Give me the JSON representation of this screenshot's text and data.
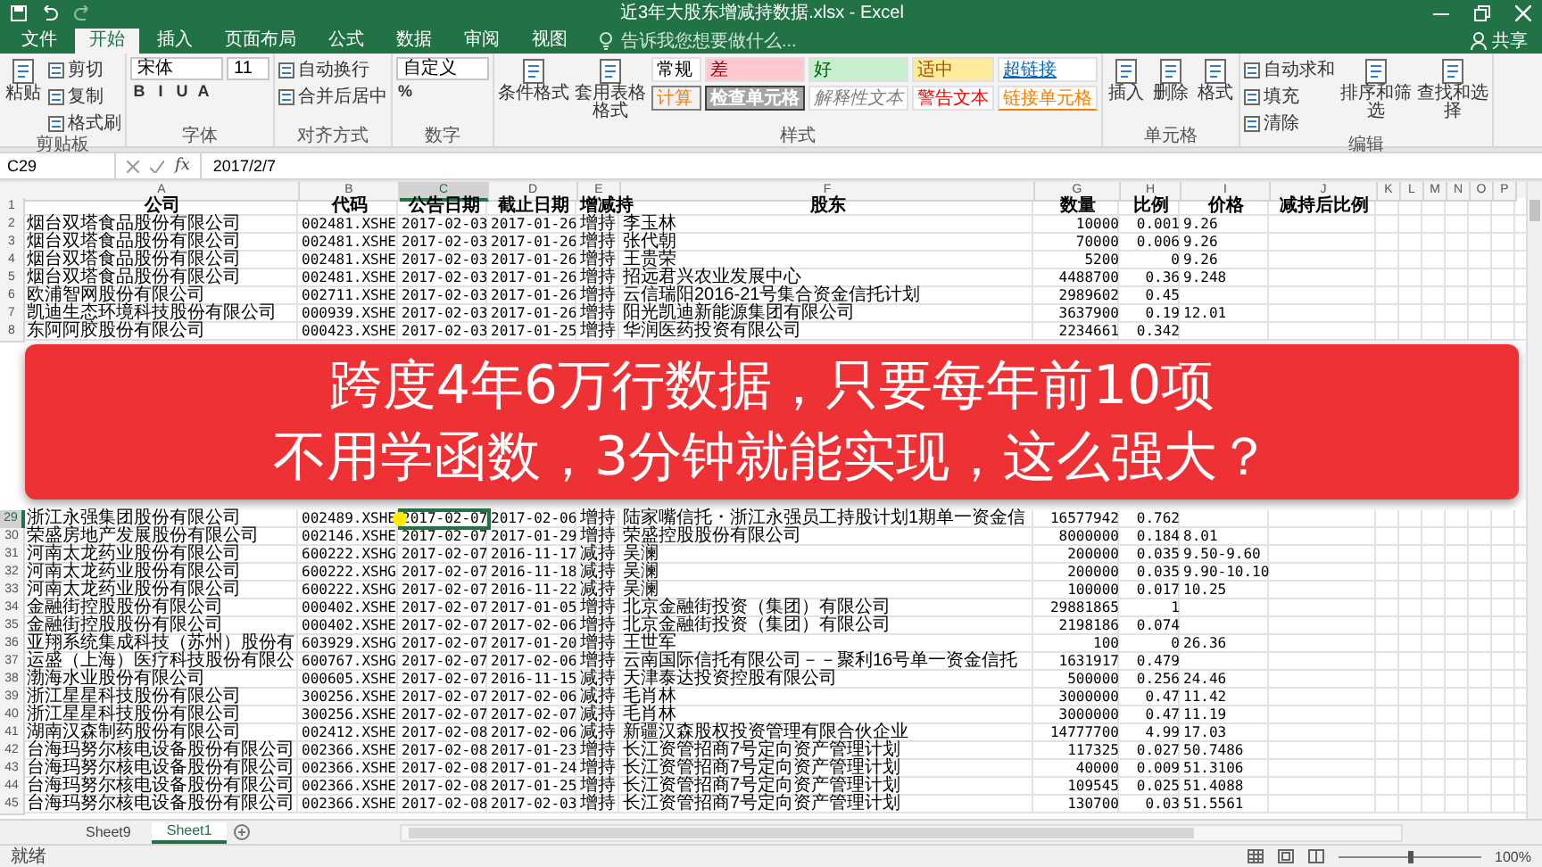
{
  "window": {
    "title": "近3年大股东增减持数据.xlsx - Excel"
  },
  "tabs": [
    {
      "label": "文件",
      "selected": false
    },
    {
      "label": "开始",
      "selected": true
    },
    {
      "label": "插入",
      "selected": false
    },
    {
      "label": "页面布局",
      "selected": false
    },
    {
      "label": "公式",
      "selected": false
    },
    {
      "label": "数据",
      "selected": false
    },
    {
      "label": "审阅",
      "selected": false
    },
    {
      "label": "视图",
      "selected": false
    }
  ],
  "search": {
    "placeholder": "告诉我您想要做什么..."
  },
  "share": "共享",
  "ribbon": [
    {
      "label": "剪贴板",
      "large": [
        "粘贴"
      ],
      "small": [
        "剪切",
        "复制",
        "格式刷"
      ]
    },
    {
      "label": "字体",
      "fields": [
        "宋体",
        "11"
      ],
      "glyphs": [
        "B",
        "I",
        "U",
        "A"
      ]
    },
    {
      "label": "对齐方式",
      "small": [
        "自动换行",
        "合并后居中"
      ]
    },
    {
      "label": "数字",
      "fields": [
        "自定义"
      ],
      "glyphs": [
        "%"
      ]
    },
    {
      "label": "样式",
      "large": [
        "条件格式",
        "套用表格格式"
      ],
      "gallery": [
        "常规",
        "差",
        "好",
        "适中",
        "超链接",
        "计算",
        "检查单元格",
        "解释性文本",
        "警告文本",
        "链接单元格"
      ]
    },
    {
      "label": "单元格",
      "large": [
        "插入",
        "删除",
        "格式"
      ]
    },
    {
      "label": "编辑",
      "small": [
        "自动求和",
        "填充",
        "清除"
      ],
      "large_after": [
        "排序和筛选",
        "查找和选择"
      ]
    }
  ],
  "formula_bar": {
    "name_box": "C29",
    "fx": "fx",
    "formula": "2017/2/7"
  },
  "sheet": {
    "columns": [
      {
        "letter": "A",
        "selected": false
      },
      {
        "letter": "B",
        "selected": false
      },
      {
        "letter": "C",
        "selected": true
      },
      {
        "letter": "D",
        "selected": false
      },
      {
        "letter": "E",
        "selected": false
      },
      {
        "letter": "F",
        "selected": false
      },
      {
        "letter": "G",
        "selected": false
      },
      {
        "letter": "H",
        "selected": false
      },
      {
        "letter": "I",
        "selected": false
      },
      {
        "letter": "J",
        "selected": false
      },
      {
        "letter": "K",
        "selected": false
      },
      {
        "letter": "L",
        "selected": false
      },
      {
        "letter": "M",
        "selected": false
      },
      {
        "letter": "N",
        "selected": false
      },
      {
        "letter": "O",
        "selected": false
      },
      {
        "letter": "P",
        "selected": false
      }
    ],
    "header": {
      "n": "1",
      "selected": false,
      "cells": [
        "公司",
        "代码",
        "公告日期",
        "截止日期",
        "增减持",
        "股东",
        "数量",
        "比例",
        "价格",
        "减持后比例"
      ]
    },
    "rows_above": [
      {
        "n": "2",
        "selected": false,
        "cells": [
          "烟台双塔食品股份有限公司",
          "002481.XSHE",
          "2017-02-03",
          "2017-01-26",
          "增持",
          "李玉林",
          "10000",
          "0.001",
          "9.26"
        ]
      },
      {
        "n": "3",
        "selected": false,
        "cells": [
          "烟台双塔食品股份有限公司",
          "002481.XSHE",
          "2017-02-03",
          "2017-01-26",
          "增持",
          "张代朝",
          "70000",
          "0.006",
          "9.26"
        ]
      },
      {
        "n": "4",
        "selected": false,
        "cells": [
          "烟台双塔食品股份有限公司",
          "002481.XSHE",
          "2017-02-03",
          "2017-01-26",
          "增持",
          "王贵荣",
          "5200",
          "0",
          "9.26"
        ]
      },
      {
        "n": "5",
        "selected": false,
        "cells": [
          "烟台双塔食品股份有限公司",
          "002481.XSHE",
          "2017-02-03",
          "2017-01-26",
          "增持",
          "招远君兴农业发展中心",
          "4488700",
          "0.36",
          "9.248"
        ]
      },
      {
        "n": "6",
        "selected": false,
        "cells": [
          "欧浦智网股份有限公司",
          "002711.XSHE",
          "2017-02-03",
          "2017-01-26",
          "增持",
          "云信瑞阳2016-21号集合资金信托计划",
          "2989602",
          "0.45"
        ]
      },
      {
        "n": "7",
        "selected": false,
        "cells": [
          "凯迪生态环境科技股份有限公司",
          "000939.XSHE",
          "2017-02-03",
          "2017-01-26",
          "增持",
          "阳光凯迪新能源集团有限公司",
          "3637900",
          "0.19",
          "12.01"
        ]
      },
      {
        "n": "8",
        "selected": false,
        "cells": [
          "东阿阿胶股份有限公司",
          "000423.XSHE",
          "2017-02-03",
          "2017-01-25",
          "增持",
          "华润医药投资有限公司",
          "2234661",
          "0.342"
        ]
      }
    ],
    "rows_below": [
      {
        "n": "29",
        "selected": true,
        "cells": [
          "浙江永强集团股份有限公司",
          "002489.XSHE",
          "2017-02-07",
          "2017-02-06",
          "增持",
          "陆家嘴信托・浙江永强员工持股计划1期单一资金信",
          "16577942",
          "0.762"
        ]
      },
      {
        "n": "30",
        "selected": false,
        "cells": [
          "荣盛房地产发展股份有限公司",
          "002146.XSHE",
          "2017-02-07",
          "2017-01-29",
          "增持",
          "荣盛控股股份有限公司",
          "8000000",
          "0.184",
          "8.01"
        ]
      },
      {
        "n": "31",
        "selected": false,
        "cells": [
          "河南太龙药业股份有限公司",
          "600222.XSHG",
          "2017-02-07",
          "2016-11-17",
          "减持",
          "吴澜",
          "200000",
          "0.035",
          "9.50-9.60"
        ]
      },
      {
        "n": "32",
        "selected": false,
        "cells": [
          "河南太龙药业股份有限公司",
          "600222.XSHG",
          "2017-02-07",
          "2016-11-18",
          "减持",
          "吴澜",
          "200000",
          "0.035",
          "9.90-10.10"
        ]
      },
      {
        "n": "33",
        "selected": false,
        "cells": [
          "河南太龙药业股份有限公司",
          "600222.XSHG",
          "2017-02-07",
          "2016-11-22",
          "减持",
          "吴澜",
          "100000",
          "0.017",
          "10.25"
        ]
      },
      {
        "n": "34",
        "selected": false,
        "cells": [
          "金融街控股股份有限公司",
          "000402.XSHE",
          "2017-02-07",
          "2017-01-05",
          "增持",
          "北京金融街投资（集团）有限公司",
          "29881865",
          "1"
        ]
      },
      {
        "n": "35",
        "selected": false,
        "cells": [
          "金融街控股股份有限公司",
          "000402.XSHE",
          "2017-02-07",
          "2017-02-06",
          "增持",
          "北京金融街投资（集团）有限公司",
          "2198186",
          "0.074"
        ]
      },
      {
        "n": "36",
        "selected": false,
        "cells": [
          "亚翔系统集成科技（苏州）股份有",
          "603929.XSHG",
          "2017-02-07",
          "2017-01-20",
          "增持",
          "王世军",
          "100",
          "0",
          "26.36"
        ]
      },
      {
        "n": "37",
        "selected": false,
        "cells": [
          "运盛（上海）医疗科技股份有限公",
          "600767.XSHG",
          "2017-02-07",
          "2017-02-06",
          "增持",
          "云南国际信托有限公司－－聚利16号单一资金信托",
          "1631917",
          "0.479"
        ]
      },
      {
        "n": "38",
        "selected": false,
        "cells": [
          "渤海水业股份有限公司",
          "000605.XSHE",
          "2017-02-07",
          "2016-11-15",
          "减持",
          "天津泰达投资控股有限公司",
          "500000",
          "0.256",
          "24.46"
        ]
      },
      {
        "n": "39",
        "selected": false,
        "cells": [
          "浙江星星科技股份有限公司",
          "300256.XSHE",
          "2017-02-07",
          "2017-02-06",
          "减持",
          "毛肖林",
          "3000000",
          "0.47",
          "11.42"
        ]
      },
      {
        "n": "40",
        "selected": false,
        "cells": [
          "浙江星星科技股份有限公司",
          "300256.XSHE",
          "2017-02-07",
          "2017-02-07",
          "减持",
          "毛肖林",
          "3000000",
          "0.47",
          "11.19"
        ]
      },
      {
        "n": "41",
        "selected": false,
        "cells": [
          "湖南汉森制药股份有限公司",
          "002412.XSHE",
          "2017-02-08",
          "2017-02-06",
          "减持",
          "新疆汉森股权投资管理有限合伙企业",
          "14777700",
          "4.99",
          "17.03"
        ]
      },
      {
        "n": "42",
        "selected": false,
        "cells": [
          "台海玛努尔核电设备股份有限公司",
          "002366.XSHE",
          "2017-02-08",
          "2017-01-23",
          "增持",
          "长江资管招商7号定向资产管理计划",
          "117325",
          "0.027",
          "50.7486"
        ]
      },
      {
        "n": "43",
        "selected": false,
        "cells": [
          "台海玛努尔核电设备股份有限公司",
          "002366.XSHE",
          "2017-02-08",
          "2017-01-24",
          "增持",
          "长江资管招商7号定向资产管理计划",
          "40000",
          "0.009",
          "51.3106"
        ]
      },
      {
        "n": "44",
        "selected": false,
        "cells": [
          "台海玛努尔核电设备股份有限公司",
          "002366.XSHE",
          "2017-02-08",
          "2017-01-25",
          "增持",
          "长江资管招商7号定向资产管理计划",
          "109545",
          "0.025",
          "51.4088"
        ]
      },
      {
        "n": "45",
        "selected": false,
        "cells": [
          "台海玛努尔核电设备股份有限公司",
          "002366.XSHE",
          "2017-02-08",
          "2017-02-03",
          "增持",
          "长江资管招商7号定向资产管理计划",
          "130700",
          "0.03",
          "51.5561"
        ]
      }
    ]
  },
  "banner": {
    "lines": [
      "跨度4年6万行数据，只要每年前10项",
      "不用学函数，3分钟就能实现，这么强大？"
    ]
  },
  "sheet_tabs": [
    {
      "label": "Sheet9",
      "selected": false
    },
    {
      "label": "Sheet1",
      "selected": true
    }
  ],
  "status_bar": {
    "status": "就绪",
    "zoom_slider": {
      "level": 0.5
    },
    "zoom": "100%"
  }
}
